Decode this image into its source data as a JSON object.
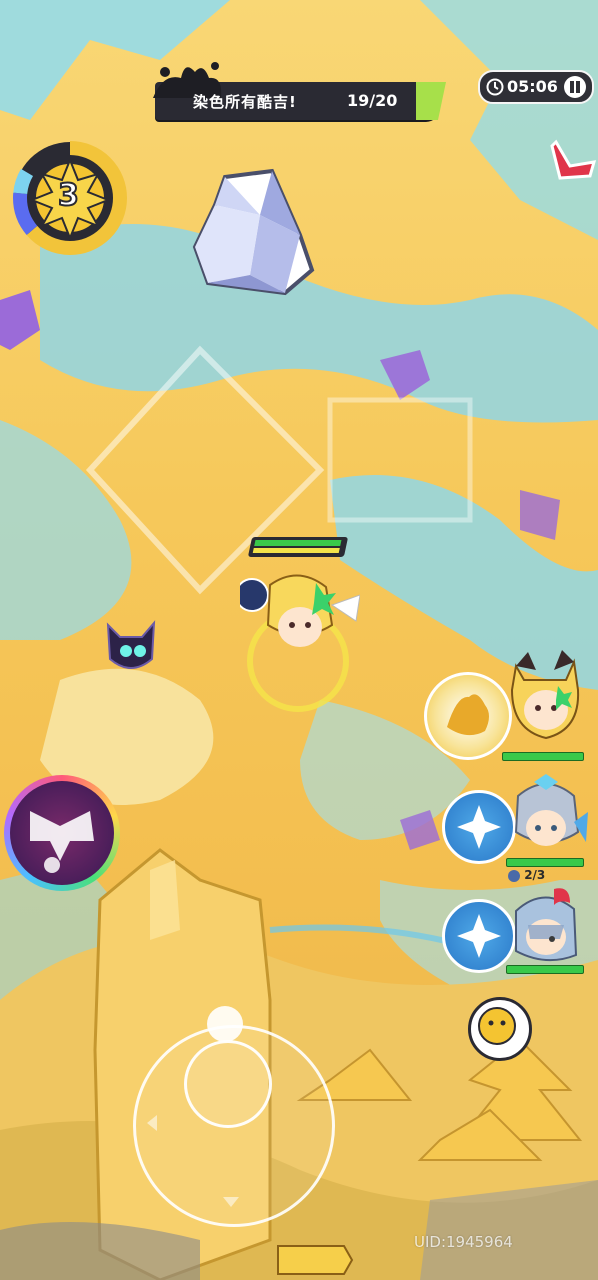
{
  "mission": {
    "text": "染色所有酷吉!",
    "progress": "19/20"
  },
  "timer": {
    "time": "05:06"
  },
  "level_badge": {
    "value": "3"
  },
  "party_counter": {
    "text": "2/3"
  },
  "uid": {
    "text": "UID:1945964"
  },
  "colors": {
    "background": "#f6c85a",
    "paint_blue": "#7fd6ee",
    "paint_purple": "#9b6bd8",
    "hud_dark": "#2a2a33",
    "hp_green": "#39c94a",
    "accent_red": "#e0354a"
  },
  "icons": {
    "timer_icon": "clock-icon",
    "pause_icon": "pause-icon",
    "quest_arrow": "direction-arrow-icon",
    "ultimate_skill": "ultimate-skill-icon",
    "skill_fire": "burst-skill-icon",
    "skill_ice_1": "frost-skill-icon",
    "skill_ice_2": "frost-skill-icon",
    "emote": "emote-icon"
  }
}
